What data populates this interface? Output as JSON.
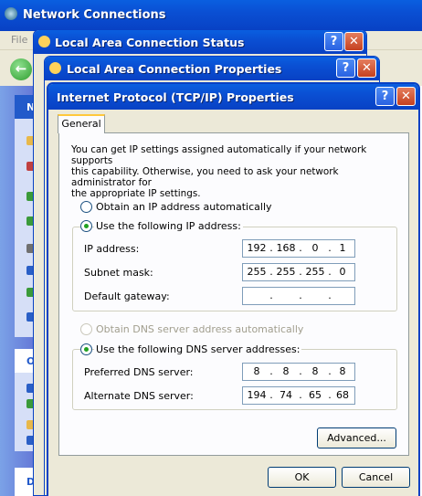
{
  "windows": {
    "network_connections": {
      "title": "Network Connections",
      "menu_file": "File"
    },
    "status": {
      "title": "Local Area Connection Status"
    },
    "properties": {
      "title": "Local Area Connection Properties"
    },
    "tcpip": {
      "title": "Internet Protocol (TCP/IP) Properties"
    }
  },
  "side_panels": {
    "panel1_letter": "N",
    "panel2_letter": "O",
    "panel3_label": "Deta"
  },
  "title_buttons": {
    "help": "?",
    "close": "✕"
  },
  "tabs": {
    "general": "General"
  },
  "description": [
    "You can get IP settings assigned automatically if your network supports",
    "this capability. Otherwise, you need to ask your network administrator for",
    "the appropriate IP settings."
  ],
  "ip": {
    "auto_label": "Obtain an IP address automatically",
    "manual_label": "Use the following IP address:",
    "selected": "manual",
    "address_label": "IP address:",
    "address": [
      "192",
      "168",
      "0",
      "1"
    ],
    "mask_label": "Subnet mask:",
    "mask": [
      "255",
      "255",
      "255",
      "0"
    ],
    "gateway_label": "Default gateway:",
    "gateway": [
      "",
      "",
      "",
      ""
    ]
  },
  "dns": {
    "auto_label": "Obtain DNS server address automatically",
    "manual_label": "Use the following DNS server addresses:",
    "selected": "manual",
    "preferred_label": "Preferred DNS server:",
    "preferred": [
      "8",
      "8",
      "8",
      "8"
    ],
    "alternate_label": "Alternate DNS server:",
    "alternate": [
      "194",
      "74",
      "65",
      "68"
    ]
  },
  "buttons": {
    "advanced": "Advanced...",
    "ok": "OK",
    "cancel": "Cancel"
  },
  "colors": {
    "titlebar": "#0a4fd3",
    "accent_tab": "#ffc83c",
    "radio_dot": "#21a121"
  }
}
